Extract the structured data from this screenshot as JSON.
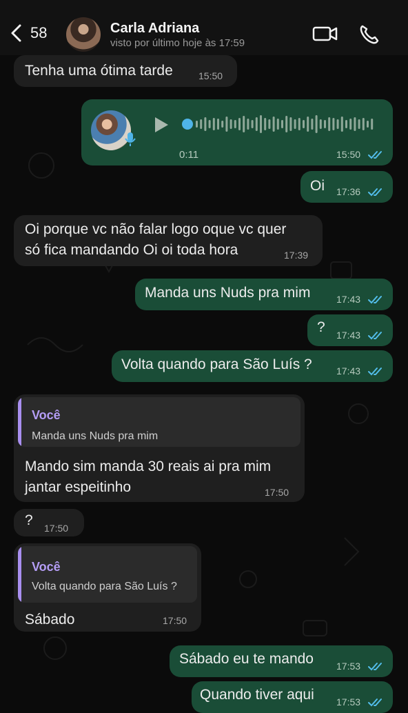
{
  "header": {
    "back_count": "58",
    "contact_name": "Carla Adriana",
    "status": "visto por último hoje às 17:59"
  },
  "messages": [
    {
      "dir": "in",
      "text": "Tenha uma ótima tarde",
      "time": "15:50"
    },
    {
      "dir": "out",
      "type": "audio",
      "duration": "0:11",
      "time": "15:50"
    },
    {
      "dir": "out",
      "text": "Oi",
      "time": "17:36"
    },
    {
      "dir": "in",
      "text": "Oi porque vc não falar logo oque vc quer\nsó fica mandando Oi oi toda hora",
      "time": "17:39"
    },
    {
      "dir": "out",
      "text": "Manda uns Nuds pra mim",
      "time": "17:43"
    },
    {
      "dir": "out",
      "text": "?",
      "time": "17:43"
    },
    {
      "dir": "out",
      "text": "Volta quando para São Luís ?",
      "time": "17:43"
    },
    {
      "dir": "in",
      "quote_author": "Você",
      "quote_text": "Manda uns Nuds pra mim",
      "text": "Mando sim manda 30 reais ai pra mim\njantar espeitinho",
      "time": "17:50"
    },
    {
      "dir": "in",
      "text": "?",
      "time": "17:50"
    },
    {
      "dir": "in",
      "quote_author": "Você",
      "quote_text": "Volta quando para São Luís ?",
      "text": "Sábado",
      "time": "17:50"
    },
    {
      "dir": "out",
      "text": "Sábado eu te mando",
      "time": "17:53"
    },
    {
      "dir": "out",
      "text": "Quando tiver aqui",
      "time": "17:53"
    }
  ],
  "icons": {
    "back": "chevron-left-icon",
    "video": "video-camera-icon",
    "phone": "phone-icon",
    "read": "double-check-icon",
    "play": "play-icon",
    "mic": "microphone-icon"
  },
  "colors": {
    "incoming": "#1f1f1f",
    "outgoing": "#1a4d37",
    "ticks": "#53bdeb",
    "quote_accent": "#a98ff0"
  }
}
